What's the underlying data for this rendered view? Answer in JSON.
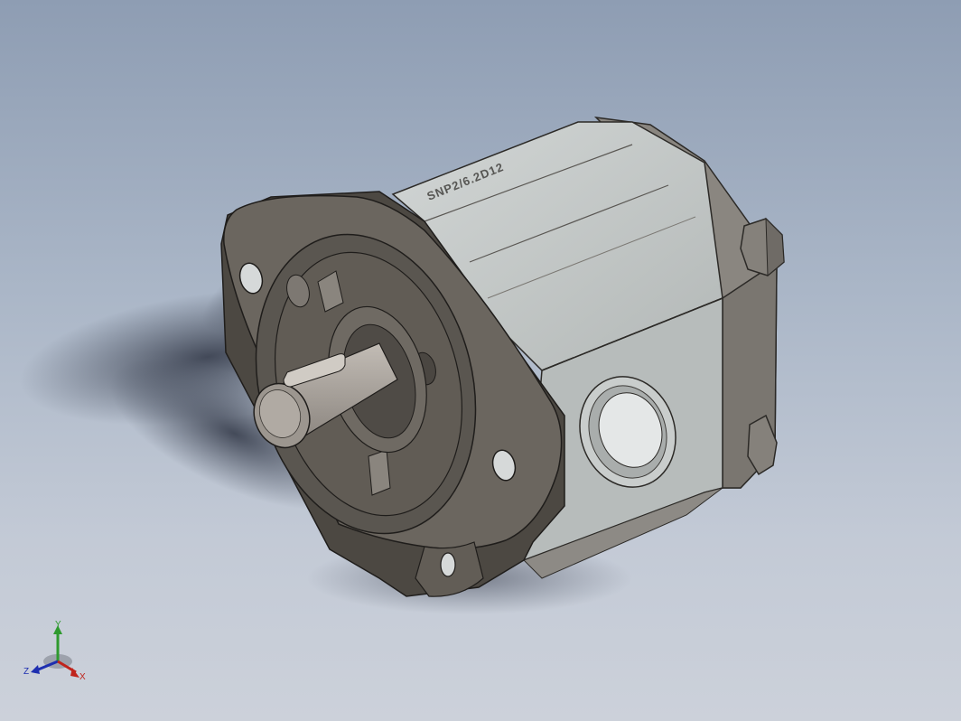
{
  "viewport": {
    "background_top": "#8e9db3",
    "background_bottom": "#ccd1da"
  },
  "model": {
    "housing_engraving": "SNP2/6.2D12 (mirrored)",
    "colors": {
      "flange": "#6b665f",
      "flange_dark": "#4c4842",
      "housing": "#b9bebd",
      "housing_light": "#c8cccb",
      "cover": "#8a8680",
      "shaft": "#a9a29b",
      "port": "#d4d8d8",
      "shadow": "#3a4150"
    }
  },
  "triad": {
    "x_label": "X",
    "y_label": "Y",
    "z_label": "Z",
    "x_color": "#c0241c",
    "y_color": "#2e9a2e",
    "z_color": "#1e2fb0"
  }
}
